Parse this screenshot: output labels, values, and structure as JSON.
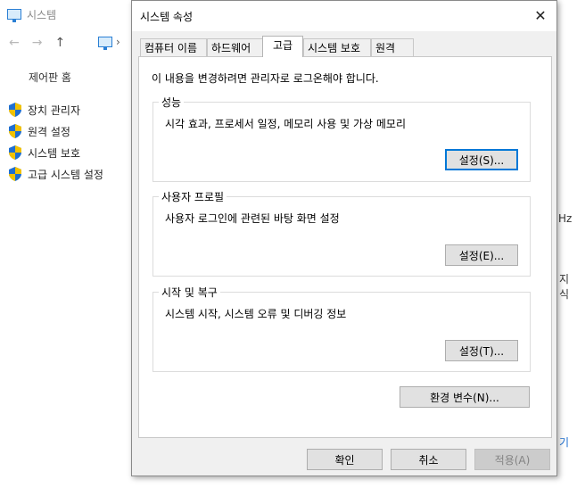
{
  "background_window": {
    "title": "시스템",
    "nav": {
      "back": "←",
      "forward": "→",
      "up": "↑",
      "separator": "›"
    },
    "home_link": "제어판 홈",
    "side_links": [
      "장치 관리자",
      "원격 설정",
      "시스템 보호",
      "고급 시스템 설정"
    ],
    "fragments": {
      "hz": "Hz",
      "kr": "지식",
      "link": "기"
    }
  },
  "dialog": {
    "title": "시스템 속성",
    "close": "✕",
    "tabs": [
      "컴퓨터 이름",
      "하드웨어",
      "고급",
      "시스템 보호",
      "원격"
    ],
    "active_tab": "고급",
    "admin_note": "이 내용을 변경하려면 관리자로 로그온해야 합니다.",
    "groups": {
      "performance": {
        "title": "성능",
        "desc": "시각 효과, 프로세서 일정, 메모리 사용 및 가상 메모리",
        "button": "설정(S)..."
      },
      "user_profiles": {
        "title": "사용자 프로필",
        "desc": "사용자 로그인에 관련된 바탕 화면 설정",
        "button": "설정(E)..."
      },
      "startup": {
        "title": "시작 및 복구",
        "desc": "시스템 시작, 시스템 오류 및 디버깅 정보",
        "button": "설정(T)..."
      }
    },
    "env_button": "환경 변수(N)...",
    "ok": "확인",
    "cancel": "취소",
    "apply": "적용(A)"
  },
  "colors": {
    "accent": "#0078d7",
    "shield_blue": "#1f6fd1",
    "shield_gold": "#f2c200"
  }
}
